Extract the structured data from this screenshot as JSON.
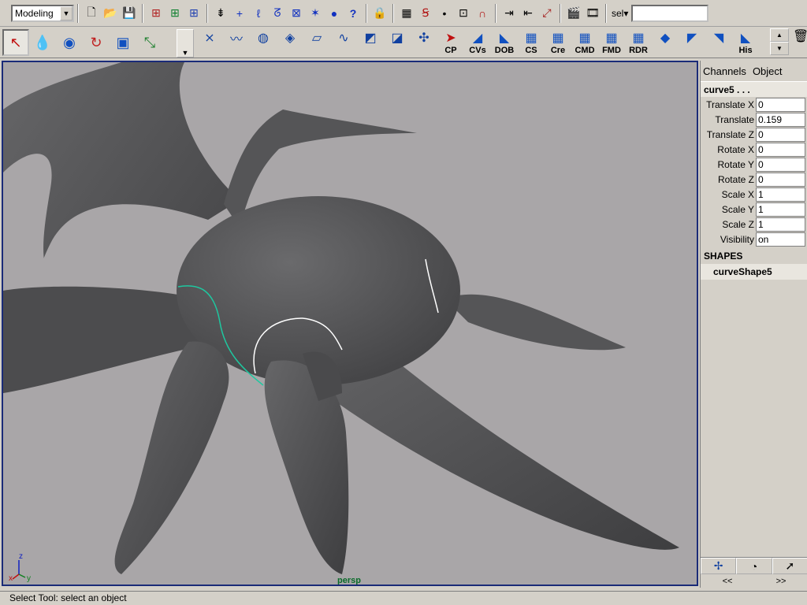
{
  "status_line": {
    "menu_set": "Modeling",
    "select_label": "sel",
    "select_arrow": "▾",
    "select_input_value": ""
  },
  "shelf": {
    "items": [
      {
        "icon": "⨯",
        "label": ""
      },
      {
        "icon": "〰",
        "label": ""
      },
      {
        "icon": "◍",
        "label": ""
      },
      {
        "icon": "◈",
        "label": ""
      },
      {
        "icon": "▱",
        "label": ""
      },
      {
        "icon": "∿",
        "label": ""
      },
      {
        "icon": "◩",
        "label": ""
      },
      {
        "icon": "◪",
        "label": ""
      },
      {
        "icon": "✣",
        "label": ""
      },
      {
        "icon": "➤",
        "label": "CP"
      },
      {
        "icon": "◢",
        "label": "CVs"
      },
      {
        "icon": "◣",
        "label": "DOB"
      },
      {
        "icon": "▦",
        "label": "CS"
      },
      {
        "icon": "▦",
        "label": "Cre"
      },
      {
        "icon": "▦",
        "label": "CMD"
      },
      {
        "icon": "▦",
        "label": "FMD"
      },
      {
        "icon": "▦",
        "label": "RDR"
      },
      {
        "icon": "◆",
        "label": ""
      },
      {
        "icon": "◤",
        "label": ""
      },
      {
        "icon": "◥",
        "label": ""
      },
      {
        "icon": "◣",
        "label": "His"
      }
    ]
  },
  "viewport": {
    "camera": "persp",
    "axis_z": "z",
    "axis_x": "x",
    "axis_y": "y",
    "colors": {
      "background": "#a9a6a8",
      "mesh": "#5a5a5c",
      "selected_curve": "#1ec8a0",
      "curve": "#ffffff"
    }
  },
  "channel_box": {
    "tabs": [
      "Channels",
      "Object"
    ],
    "object_name": "curve5 . . .",
    "attributes": [
      {
        "label": "Translate X",
        "value": "0"
      },
      {
        "label": "Translate",
        "value": "0.159"
      },
      {
        "label": "Translate Z",
        "value": "0"
      },
      {
        "label": "Rotate X",
        "value": "0"
      },
      {
        "label": "Rotate Y",
        "value": "0"
      },
      {
        "label": "Rotate Z",
        "value": "0"
      },
      {
        "label": "Scale X",
        "value": "1"
      },
      {
        "label": "Scale Y",
        "value": "1"
      },
      {
        "label": "Scale Z",
        "value": "1"
      },
      {
        "label": "Visibility",
        "value": "on"
      }
    ],
    "shapes_label": "SHAPES",
    "shape_name": "curveShape5",
    "pager_prev": "<<",
    "pager_next": ">>"
  },
  "help_line": "Select Tool: select an object"
}
